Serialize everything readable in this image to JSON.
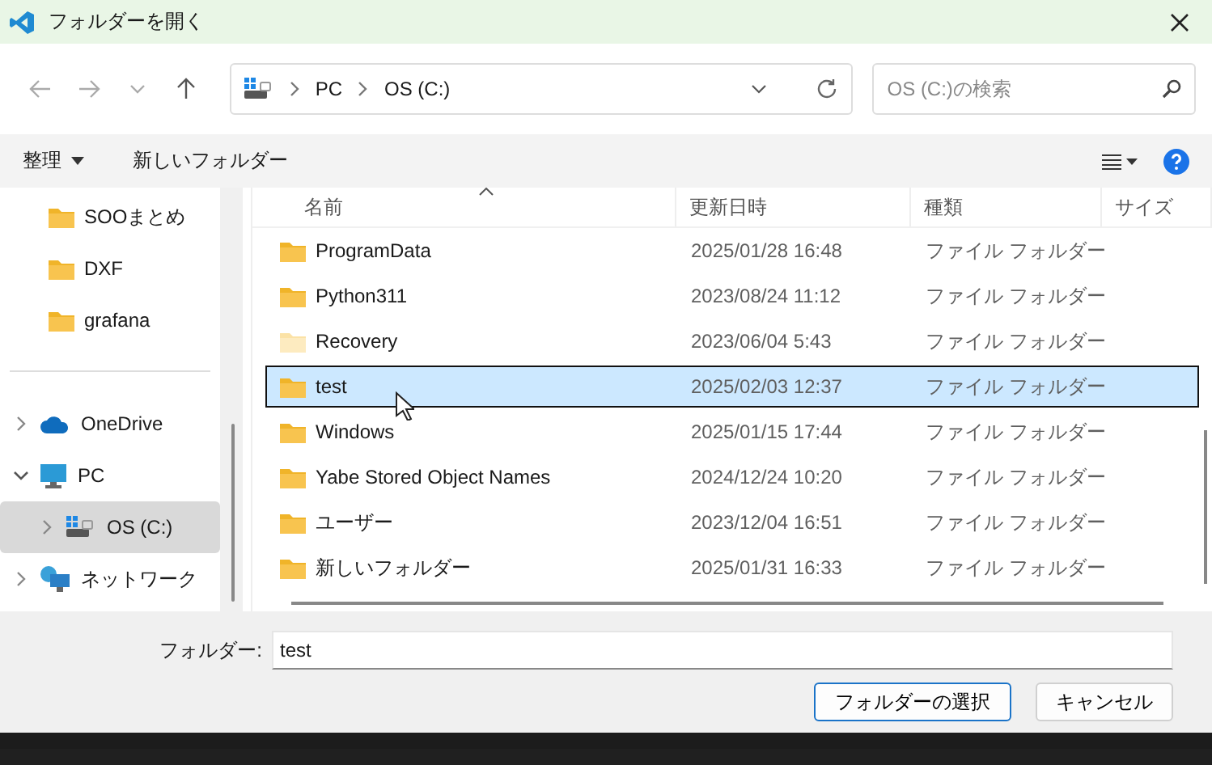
{
  "window": {
    "title": "フォルダーを開く"
  },
  "nav": {
    "path": [
      "PC",
      "OS (C:)"
    ],
    "search": {
      "placeholder": "OS (C:)の検索"
    }
  },
  "command_bar": {
    "buttons": [
      "整理",
      "新しいフォルダー"
    ]
  },
  "sidebar": {
    "quick_items": [
      {
        "label": "SOOまとめ",
        "selected": false
      },
      {
        "label": "DXF",
        "selected": false
      },
      {
        "label": "grafana",
        "selected": false
      }
    ],
    "tree": [
      {
        "label": "OneDrive",
        "kind": "cloud",
        "expanded": false,
        "selected": false
      },
      {
        "label": "PC",
        "kind": "pc",
        "expanded": true,
        "selected": false,
        "children": [
          {
            "label": "OS (C:)",
            "kind": "drive",
            "expanded": false,
            "selected": true
          }
        ]
      },
      {
        "label": "ネットワーク",
        "kind": "network",
        "expanded": false,
        "selected": false
      }
    ]
  },
  "table": {
    "columns": [
      "名前",
      "更新日時",
      "種類",
      "サイズ"
    ],
    "rows": [
      {
        "name": "ProgramData",
        "modified": "2025/01/28 16:48",
        "type": "ファイル フォルダー",
        "dimmed": false,
        "selected": false
      },
      {
        "name": "Python311",
        "modified": "2023/08/24 11:12",
        "type": "ファイル フォルダー",
        "dimmed": false,
        "selected": false
      },
      {
        "name": "Recovery",
        "modified": "2023/06/04 5:43",
        "type": "ファイル フォルダー",
        "dimmed": true,
        "selected": false
      },
      {
        "name": "test",
        "modified": "2025/02/03 12:37",
        "type": "ファイル フォルダー",
        "dimmed": false,
        "selected": true
      },
      {
        "name": "Windows",
        "modified": "2025/01/15 17:44",
        "type": "ファイル フォルダー",
        "dimmed": false,
        "selected": false
      },
      {
        "name": "Yabe Stored Object Names",
        "modified": "2024/12/24 10:20",
        "type": "ファイル フォルダー",
        "dimmed": false,
        "selected": false
      },
      {
        "name": "ユーザー",
        "modified": "2023/12/04 16:51",
        "type": "ファイル フォルダー",
        "dimmed": false,
        "selected": false
      },
      {
        "name": "新しいフォルダー",
        "modified": "2025/01/31 16:33",
        "type": "ファイル フォルダー",
        "dimmed": false,
        "selected": false
      }
    ]
  },
  "footer": {
    "field_label": "フォルダー:",
    "field_value": "test",
    "buttons": [
      "フォルダーの選択",
      "キャンセル"
    ]
  }
}
